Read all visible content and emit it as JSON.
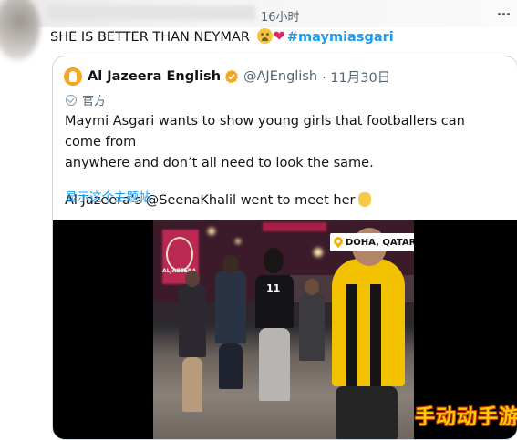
{
  "header": {
    "timestamp": "16小时"
  },
  "tweet": {
    "text": "SHE IS BETTER THAN NEYMAR",
    "hashtag": "#maymiasgari"
  },
  "quoted": {
    "author": "Al Jazeera English",
    "handle": "@AJEnglish",
    "date": "· 11月30日",
    "label": "官方",
    "body_line1": "Maymi Asgari wants to show young girls that footballers can come from",
    "body_line2": "anywhere and don’t all need to look the same.",
    "body_line3": "Al Jazeera’s @SeenaKhalil went to meet her",
    "show_thread": "显示这个主题帖"
  },
  "video": {
    "location": "DOHA, QATAR",
    "logo_text": "ALJAZEERA",
    "jersey_number": "11"
  },
  "watermark": "手动动手游",
  "colors": {
    "accent": "#1d9bf0",
    "verified": "#f5a623",
    "heart": "#e0245e"
  }
}
